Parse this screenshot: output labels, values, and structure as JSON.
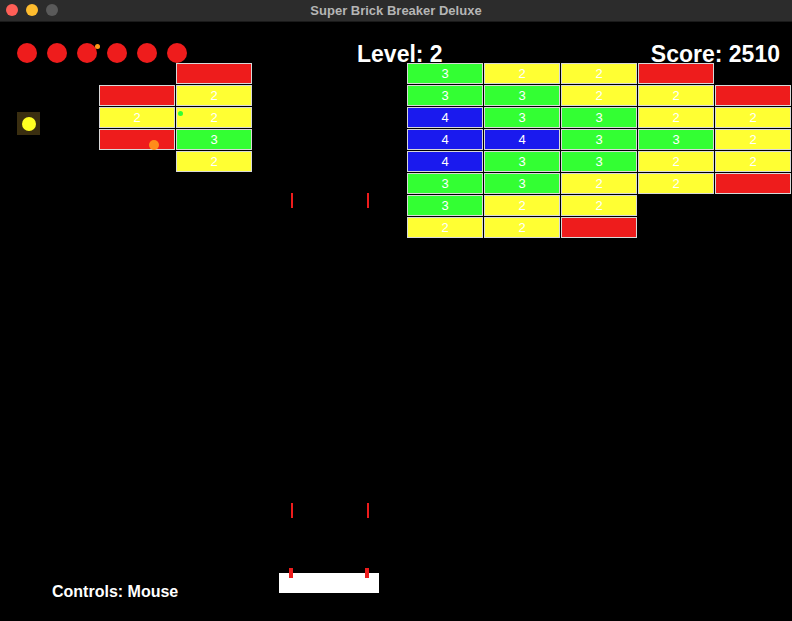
{
  "window": {
    "title": "Super Brick Breaker Deluxe"
  },
  "hud": {
    "lives": 6,
    "level": "Level: 2",
    "score": "Score: 2510",
    "controls": "Controls: Mouse"
  },
  "bricks": {
    "left": [
      [
        null,
        {
          "color": "#ee1c1c"
        }
      ],
      [
        {
          "color": "#ee1c1c"
        },
        {
          "color": "#ffff33",
          "label": "2"
        }
      ],
      [
        {
          "color": "#ffff33",
          "label": "2"
        },
        {
          "color": "#ffff33",
          "label": "2"
        }
      ],
      [
        {
          "color": "#ee1c1c"
        },
        {
          "color": "#33ff33",
          "label": "3"
        }
      ],
      [
        null,
        {
          "color": "#ffff33",
          "label": "2"
        }
      ]
    ],
    "right": [
      [
        {
          "color": "#33ff33",
          "label": "3"
        },
        {
          "color": "#ffff33",
          "label": "2"
        },
        {
          "color": "#ffff33",
          "label": "2"
        },
        {
          "color": "#ee1c1c"
        },
        null
      ],
      [
        {
          "color": "#33ff33",
          "label": "3"
        },
        {
          "color": "#33ff33",
          "label": "3"
        },
        {
          "color": "#ffff33",
          "label": "2"
        },
        {
          "color": "#ffff33",
          "label": "2"
        },
        {
          "color": "#ee1c1c"
        }
      ],
      [
        {
          "color": "#1a1aee",
          "label": "4"
        },
        {
          "color": "#33ff33",
          "label": "3"
        },
        {
          "color": "#33ff33",
          "label": "3"
        },
        {
          "color": "#ffff33",
          "label": "2"
        },
        {
          "color": "#ffff33",
          "label": "2"
        }
      ],
      [
        {
          "color": "#1a1aee",
          "label": "4"
        },
        {
          "color": "#1a1aee",
          "label": "4"
        },
        {
          "color": "#33ff33",
          "label": "3"
        },
        {
          "color": "#33ff33",
          "label": "3"
        },
        {
          "color": "#ffff33",
          "label": "2"
        }
      ],
      [
        {
          "color": "#1a1aee",
          "label": "4"
        },
        {
          "color": "#33ff33",
          "label": "3"
        },
        {
          "color": "#33ff33",
          "label": "3"
        },
        {
          "color": "#ffff33",
          "label": "2"
        },
        {
          "color": "#ffff33",
          "label": "2"
        }
      ],
      [
        {
          "color": "#33ff33",
          "label": "3"
        },
        {
          "color": "#33ff33",
          "label": "3"
        },
        {
          "color": "#ffff33",
          "label": "2"
        },
        {
          "color": "#ffff33",
          "label": "2"
        },
        {
          "color": "#ee1c1c"
        }
      ],
      [
        {
          "color": "#33ff33",
          "label": "3"
        },
        {
          "color": "#ffff33",
          "label": "2"
        },
        {
          "color": "#ffff33",
          "label": "2"
        },
        null,
        null
      ],
      [
        {
          "color": "#ffff33",
          "label": "2"
        },
        {
          "color": "#ffff33",
          "label": "2"
        },
        {
          "color": "#ee1c1c"
        },
        null,
        null
      ]
    ]
  },
  "paddle": {
    "lasers": true
  }
}
